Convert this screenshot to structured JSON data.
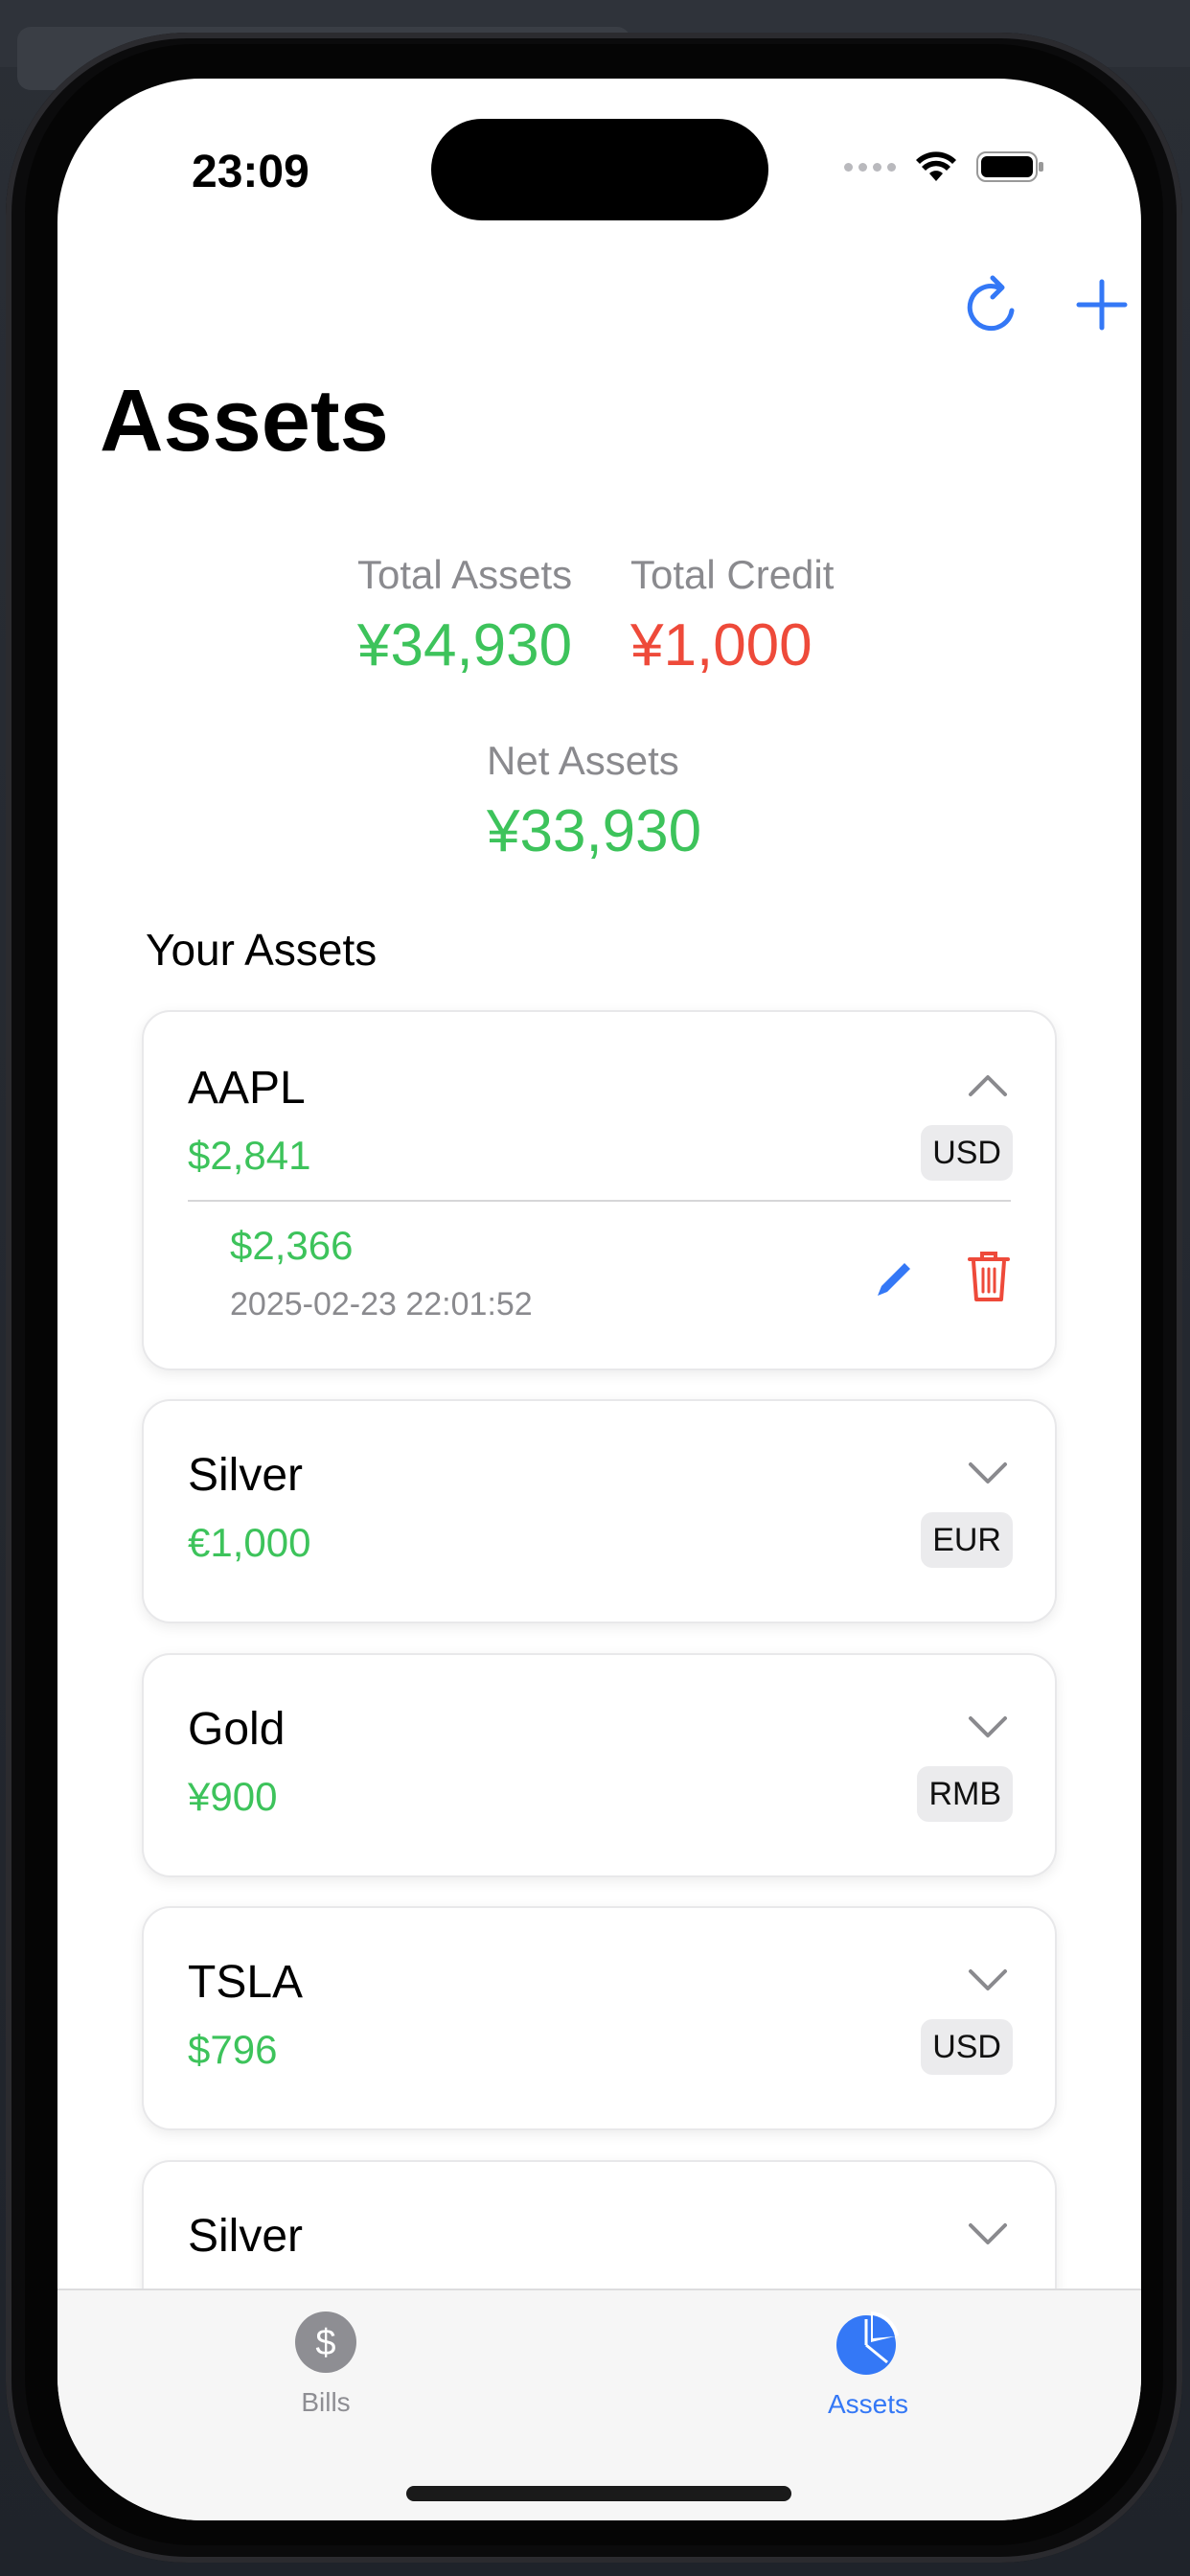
{
  "status_bar": {
    "time": "23:09"
  },
  "header": {
    "title": "Assets"
  },
  "summary": {
    "total_assets_label": "Total Assets",
    "total_assets_value": "¥34,930",
    "total_credit_label": "Total Credit",
    "total_credit_value": "¥1,000",
    "net_assets_label": "Net Assets",
    "net_assets_value": "¥33,930"
  },
  "section_title": "Your Assets",
  "assets": [
    {
      "name": "AAPL",
      "amount": "$2,841",
      "currency": "USD",
      "expanded": true,
      "entries": [
        {
          "amount": "$2,366",
          "date": "2025-02-23 22:01:52"
        }
      ]
    },
    {
      "name": "Silver",
      "amount": "€1,000",
      "currency": "EUR",
      "expanded": false
    },
    {
      "name": "Gold",
      "amount": "¥900",
      "currency": "RMB",
      "expanded": false
    },
    {
      "name": "TSLA",
      "amount": "$796",
      "currency": "USD",
      "expanded": false
    },
    {
      "name": "Silver",
      "amount": "",
      "currency": "",
      "expanded": false
    }
  ],
  "tabbar": {
    "tabs": [
      {
        "label": "Bills",
        "icon": "dollar-circle-icon",
        "active": false
      },
      {
        "label": "Assets",
        "icon": "pie-chart-icon",
        "active": true
      }
    ]
  },
  "colors": {
    "accent": "#3478f6",
    "positive": "#3dc35b",
    "negative": "#ee4a3a",
    "muted": "#8a8a8e"
  }
}
